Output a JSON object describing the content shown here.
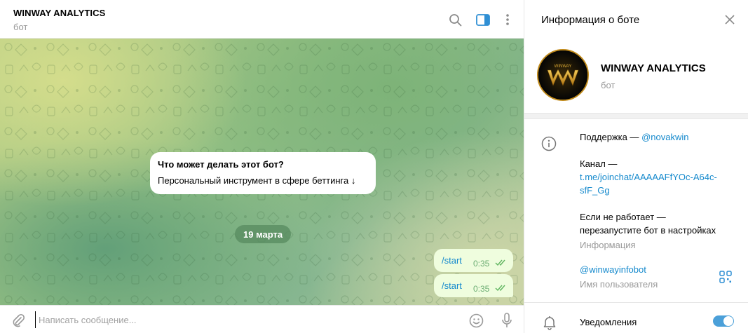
{
  "chat": {
    "title": "WINWAY ANALYTICS",
    "subtitle": "бот",
    "header_icons": [
      "search-icon",
      "sidebar-toggle-icon",
      "more-icon"
    ],
    "bot_card": {
      "title": "Что может делать этот бот?",
      "text": "Персональный инструмент в сфере беттинга ↓"
    },
    "date_label": "19 марта",
    "messages": [
      {
        "text": "/start",
        "time": "0:35"
      },
      {
        "text": "/start",
        "time": "0:35"
      }
    ],
    "composer": {
      "placeholder": "Написать сообщение..."
    },
    "accent_color": "#168acd",
    "bubble_color": "#effdde"
  },
  "info_panel": {
    "title": "Информация о боте",
    "profile": {
      "name": "WINWAY ANALYTICS",
      "subtitle": "бот",
      "avatar_text": "WINWAY",
      "avatar_mark": "W"
    },
    "about": {
      "support_label": "Поддержка —",
      "support_link": "@novakwin",
      "channel_label": "Канал —",
      "channel_link": "t.me/joinchat/AAAAAFfYOc-A64c-sfF_Gg",
      "broken_line1": "Если не работает —",
      "broken_line2": "перезапустите бот в настройках",
      "caption": "Информация"
    },
    "username": {
      "value": "@winwayinfobot",
      "caption": "Имя пользователя"
    },
    "notifications": {
      "label": "Уведомления",
      "enabled": true
    }
  }
}
